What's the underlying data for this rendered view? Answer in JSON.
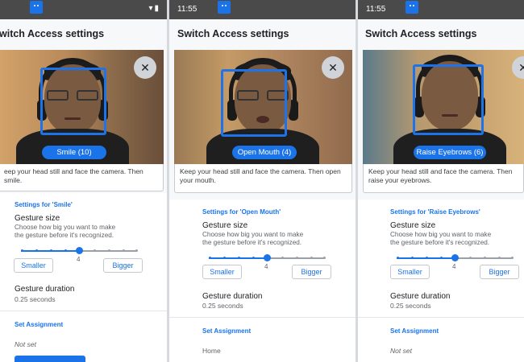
{
  "status": {
    "time": "11:55"
  },
  "app_title": "Switch Access settings",
  "app_title_cropped": "witch Access settings",
  "panels": [
    {
      "gesture_chip": "Smile (10)",
      "instruction": "eep your head still and face the camera. Then smile.",
      "settings_label": "Settings for 'Smile'",
      "gesture_size_title": "Gesture size",
      "gesture_size_desc": "Choose how big you want to make the gesture before it's recognized.",
      "slider_value": "4",
      "smaller": "Smaller",
      "bigger": "Bigger",
      "duration_title": "Gesture duration",
      "duration_value": "0.25 seconds",
      "assignment_label": "Set Assignment",
      "assignment_value": "Not set"
    },
    {
      "gesture_chip": "Open Mouth (4)",
      "instruction": "Keep your head still and face the camera. Then open your mouth.",
      "settings_label": "Settings for 'Open Mouth'",
      "gesture_size_title": "Gesture size",
      "gesture_size_desc": "Choose how big you want to make the gesture before it's recognized.",
      "slider_value": "4",
      "smaller": "Smaller",
      "bigger": "Bigger",
      "duration_title": "Gesture duration",
      "duration_value": "0.25 seconds",
      "assignment_label": "Set Assignment",
      "assignment_value": "Home"
    },
    {
      "gesture_chip": "Raise Eyebrows (6)",
      "instruction": "Keep your head still and face the camera. Then raise your eyebrows.",
      "settings_label": "Settings for 'Raise Eyebrows'",
      "gesture_size_title": "Gesture size",
      "gesture_size_desc": "Choose how big you want to make the gesture before it's recognized.",
      "slider_value": "4",
      "smaller": "Smaller",
      "bigger": "Bigger",
      "duration_title": "Gesture duration",
      "duration_value": "0.25 seconds",
      "assignment_label": "Set Assignment",
      "assignment_value": "Not set"
    }
  ],
  "colors": {
    "accent": "#1a73e8",
    "statusbar": "#4a4a4a",
    "background": "#f7f8fa"
  }
}
